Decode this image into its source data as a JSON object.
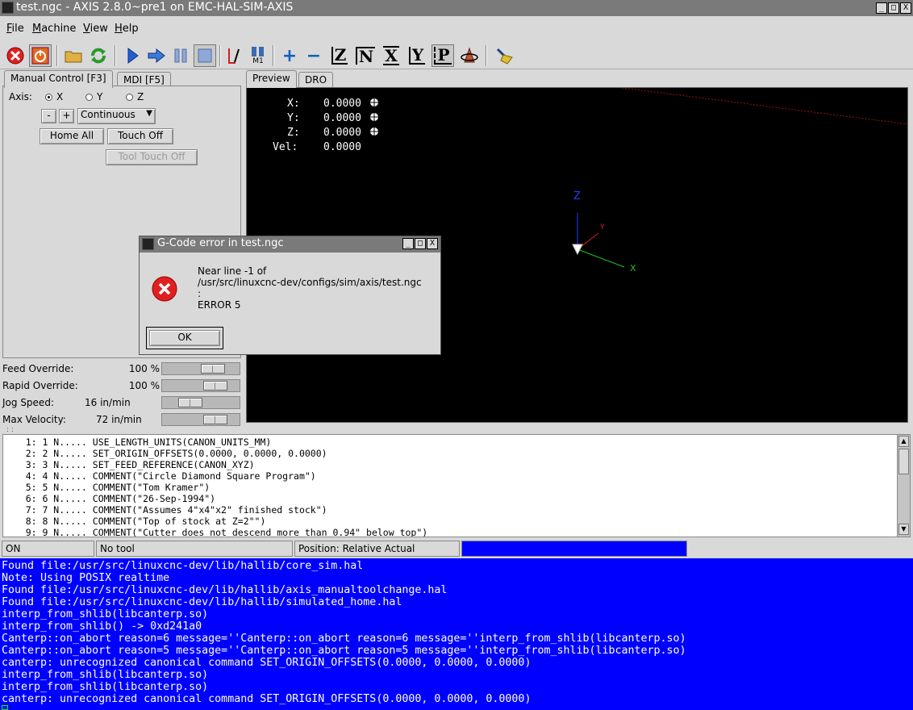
{
  "window": {
    "title": "test.ngc - AXIS 2.8.0~pre1 on EMC-HAL-SIM-AXIS",
    "minimize": "_",
    "maximize": "□",
    "close": "X"
  },
  "menubar": {
    "items": [
      {
        "label": "File",
        "accel": "F"
      },
      {
        "label": "Machine",
        "accel": "M"
      },
      {
        "label": "View",
        "accel": "V"
      },
      {
        "label": "Help",
        "accel": "H"
      }
    ]
  },
  "toolbar": {
    "icons": [
      "estop-icon",
      "power-icon",
      "open-file-icon",
      "reload-icon",
      "run-icon",
      "step-icon",
      "pause-icon",
      "stop-icon",
      "optional-block-icon",
      "optional-stop-icon",
      "zoom-in-icon",
      "zoom-out-icon",
      "view-z-icon",
      "view-z2-icon",
      "view-x-icon",
      "view-y-icon",
      "view-p-icon",
      "rotate-icon",
      "clear-plot-icon"
    ],
    "m1_label": "M1",
    "zoom_in": "+",
    "zoom_out": "−",
    "view_z": "Z",
    "view_z2": "N",
    "view_x": "X",
    "view_y": "Y",
    "view_p": "P"
  },
  "tabs_left": {
    "manual": "Manual Control [F3]",
    "mdi": "MDI [F5]"
  },
  "manual": {
    "axis_label": "Axis:",
    "axes": [
      "X",
      "Y",
      "Z"
    ],
    "selected_axis": "X",
    "minus": "-",
    "plus": "+",
    "jog_mode": "Continuous",
    "home_all": "Home All",
    "touch_off": "Touch Off",
    "tool_touch_off": "Tool Touch Off"
  },
  "sliders": [
    {
      "label": "Feed Override:",
      "value": "100 %",
      "fraction": 0.72
    },
    {
      "label": "Rapid Override:",
      "value": "100 %",
      "fraction": 0.78
    },
    {
      "label": "Jog Speed:",
      "value": "16 in/min",
      "fraction": 0.3
    },
    {
      "label": "Max Velocity:",
      "value": "72 in/min",
      "fraction": 0.78
    }
  ],
  "tabs_right": {
    "preview": "Preview",
    "dro": "DRO"
  },
  "dro": [
    {
      "label": "X:",
      "value": "0.0000"
    },
    {
      "label": "Y:",
      "value": "0.0000"
    },
    {
      "label": "Z:",
      "value": "0.0000"
    },
    {
      "label": "Vel:",
      "value": "0.0000"
    }
  ],
  "preview_axes": {
    "z": "Z",
    "y": "Y",
    "x": "X"
  },
  "gcode": [
    "    1: 1 N..... USE_LENGTH_UNITS(CANON_UNITS_MM)",
    "    2: 2 N..... SET_ORIGIN_OFFSETS(0.0000, 0.0000, 0.0000)",
    "    3: 3 N..... SET_FEED_REFERENCE(CANON_XYZ)",
    "    4: 4 N..... COMMENT(\"Circle Diamond Square Program\")",
    "    5: 5 N..... COMMENT(\"Tom Kramer\")",
    "    6: 6 N..... COMMENT(\"26-Sep-1994\")",
    "    7: 7 N..... COMMENT(\"Assumes 4\"x4\"x2\" finished stock\")",
    "    8: 8 N..... COMMENT(\"Top of stock at Z=2\"\")",
    "    9: 9 N..... COMMENT(\"Cutter does not descend more than 0.94\" below top\")"
  ],
  "status": {
    "machine": "ON",
    "tool": "No tool",
    "position": "Position: Relative Actual",
    "progress_fraction": 1.0,
    "progress_color": "#0000ff"
  },
  "console": [
    "Found file:/usr/src/linuxcnc-dev/lib/hallib/core_sim.hal",
    "Note: Using POSIX realtime",
    "Found file:/usr/src/linuxcnc-dev/lib/hallib/axis_manualtoolchange.hal",
    "Found file:/usr/src/linuxcnc-dev/lib/hallib/simulated_home.hal",
    "interp_from_shlib(libcanterp.so)",
    "interp_from_shlib() -> 0xd241a0",
    "Canterp::on_abort reason=6 message=''Canterp::on_abort reason=6 message=''interp_from_shlib(libcanterp.so)",
    "Canterp::on_abort reason=5 message=''Canterp::on_abort reason=5 message=''interp_from_shlib(libcanterp.so)",
    "canterp: unrecognized canonical command SET_ORIGIN_OFFSETS(0.0000, 0.0000, 0.0000)",
    "interp_from_shlib(libcanterp.so)",
    "interp_from_shlib(libcanterp.so)",
    "canterp: unrecognized canonical command SET_ORIGIN_OFFSETS(0.0000, 0.0000, 0.0000)"
  ],
  "dialog": {
    "title": "G-Code error in test.ngc",
    "message": "Near line -1 of\n/usr/src/linuxcnc-dev/configs/sim/axis/test.ngc\n:\nERROR 5",
    "ok": "OK"
  },
  "colors": {
    "console_bg": "#0000ff",
    "preview_bg": "#000000",
    "estop_red": "#e02020",
    "run_blue": "#2060d0"
  }
}
